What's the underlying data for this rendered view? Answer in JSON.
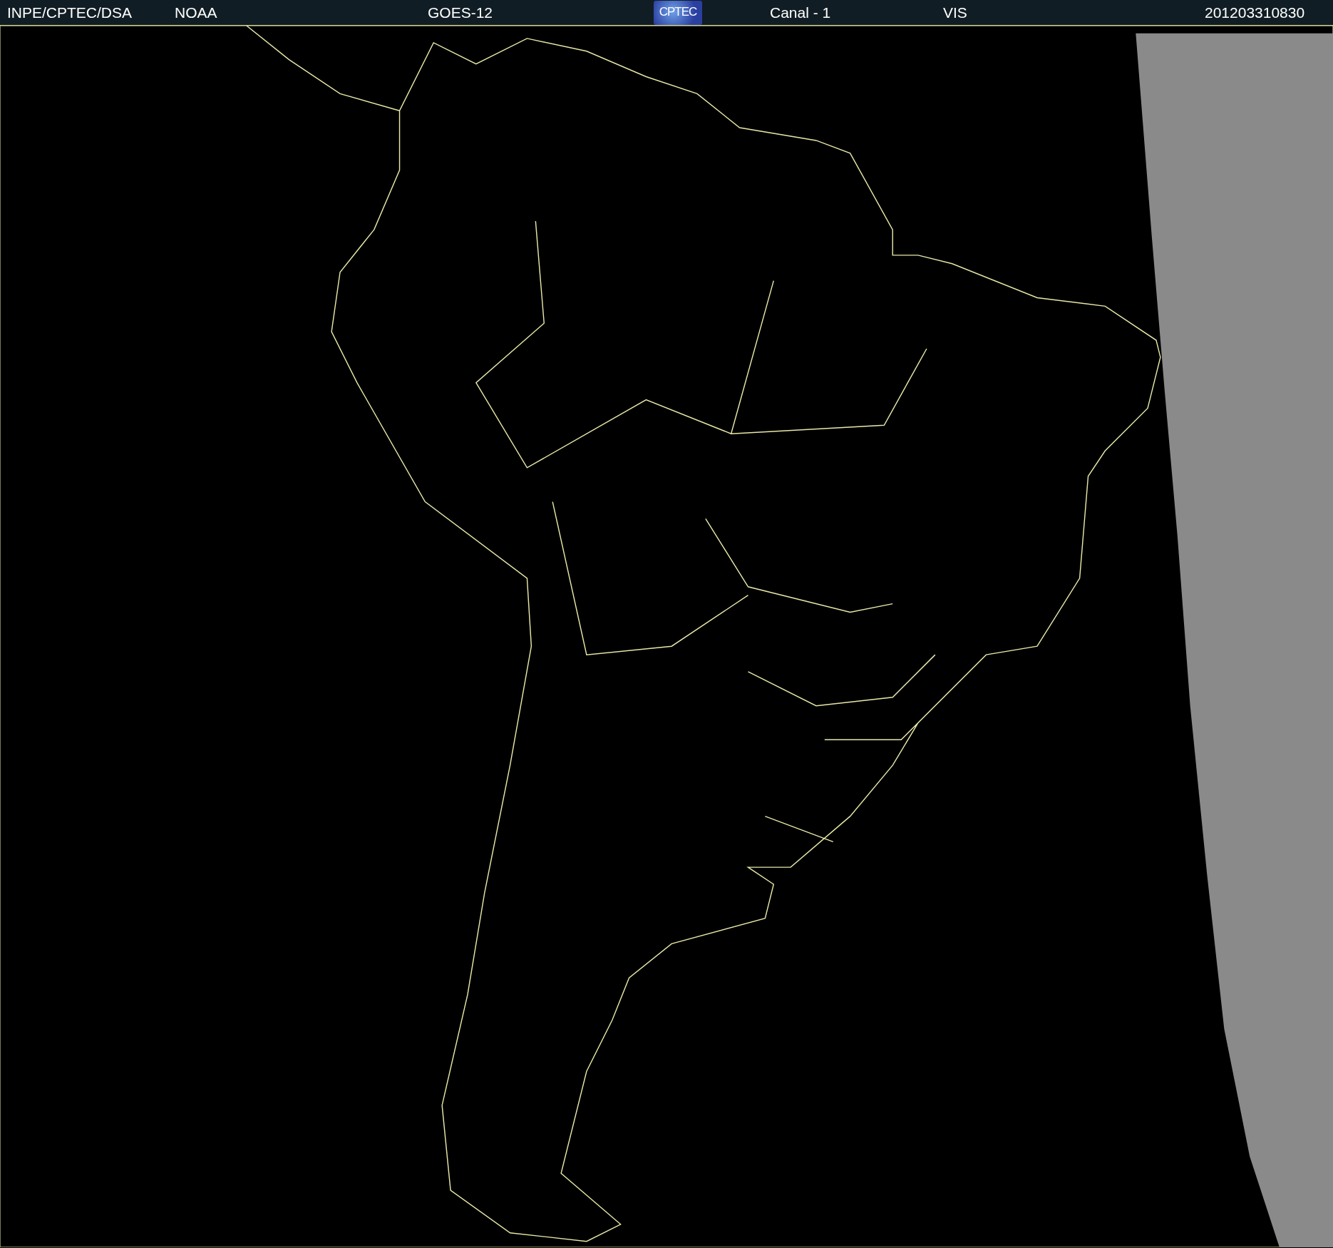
{
  "header": {
    "items": [
      {
        "kind": "text",
        "text": "INPE/CPTEC/DSA"
      },
      {
        "kind": "text",
        "text": "NOAA"
      },
      {
        "kind": "text",
        "text": "GOES-12"
      },
      {
        "kind": "logo",
        "text": "CPTEC"
      },
      {
        "kind": "text",
        "text": "Canal - 1"
      },
      {
        "kind": "text",
        "text": "VIS"
      },
      {
        "kind": "text",
        "text": "201203310830"
      }
    ]
  }
}
